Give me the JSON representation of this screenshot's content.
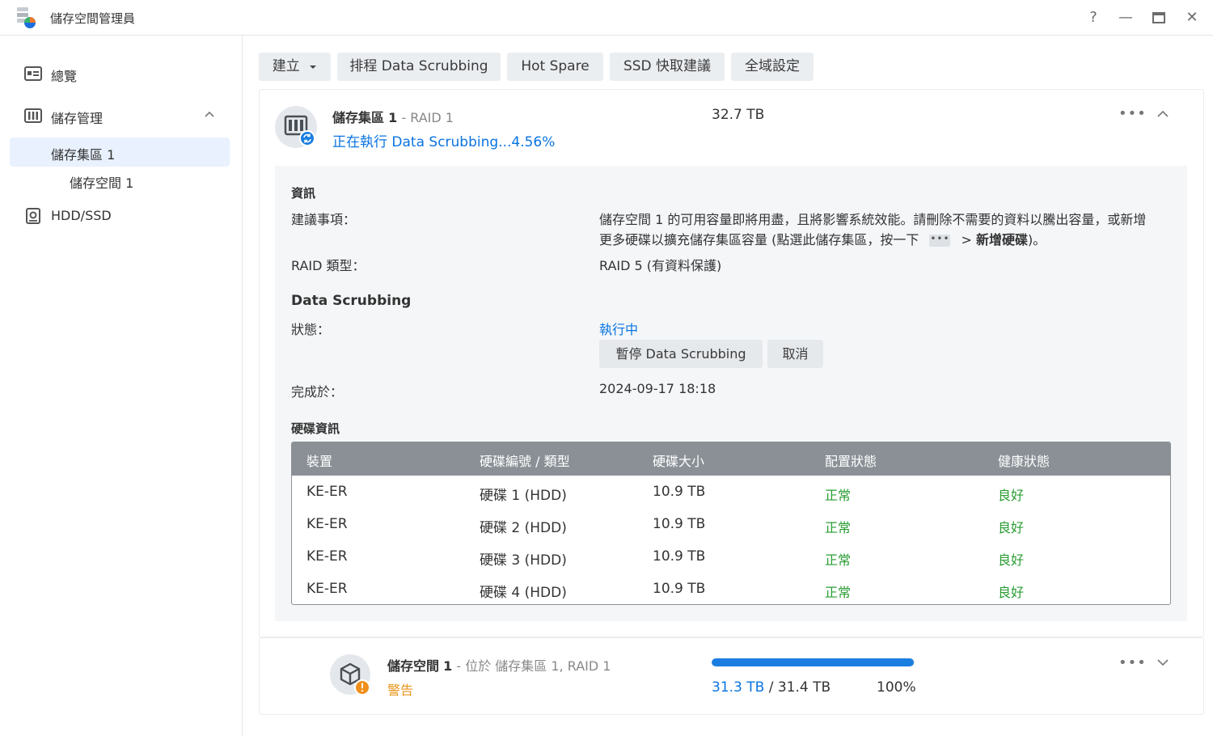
{
  "window": {
    "title": "儲存空間管理員",
    "buttons": {
      "help": "?",
      "minimize": "—",
      "maximize": "▭",
      "close": "✕"
    }
  },
  "sidebar": {
    "items": [
      {
        "label": "總覽",
        "icon": "overview-icon"
      },
      {
        "label": "儲存管理",
        "icon": "storage-icon",
        "expanded": true
      },
      {
        "label": "儲存集區 1",
        "selected": true
      },
      {
        "label": "儲存空間 1"
      },
      {
        "label": "HDD/SSD",
        "icon": "disk-icon"
      }
    ]
  },
  "toolbar": {
    "create": "建立",
    "schedule": "排程 Data Scrubbing",
    "hot_spare": "Hot Spare",
    "ssd_cache": "SSD 快取建議",
    "global": "全域設定"
  },
  "pool": {
    "name": "儲存集區",
    "number": "1",
    "separator": "-",
    "raid": "RAID 1",
    "status": "正在執行 Data Scrubbing...4.56%",
    "size": "32.7 TB",
    "info": {
      "heading": "資訊",
      "suggestion_label": "建議事項：",
      "suggestion_line1": "儲存空間 1 的可用容量即將用盡，且將影響系統效能。請刪除不需要的資料以騰出容量，或新增",
      "suggestion_line2a": "更多硬碟以擴充儲存集區容量 (點選此儲存集區，按一下",
      "suggestion_dots": "•••",
      "suggestion_line2b": "> ",
      "suggestion_bold": "新增硬碟",
      "suggestion_end": ")。",
      "raid_label": "RAID 類型：",
      "raid_value": "RAID 5 (有資料保護)"
    },
    "scrubbing": {
      "heading": "Data Scrubbing",
      "status_label": "狀態：",
      "status_value": "執行中",
      "pause_button": "暫停 Data Scrubbing",
      "cancel_button": "取消",
      "completed_label": "完成於：",
      "completed_value": "2024-09-17 18:18"
    },
    "disks": {
      "heading": "硬碟資訊",
      "columns": [
        "裝置",
        "硬碟編號 / 類型",
        "硬碟大小",
        "配置狀態",
        "健康狀態"
      ],
      "rows": [
        [
          "KE-ER",
          "硬碟 1 (HDD)",
          "10.9 TB",
          "正常",
          "良好"
        ],
        [
          "KE-ER",
          "硬碟 2 (HDD)",
          "10.9 TB",
          "正常",
          "良好"
        ],
        [
          "KE-ER",
          "硬碟 3 (HDD)",
          "10.9 TB",
          "正常",
          "良好"
        ],
        [
          "KE-ER",
          "硬碟 4 (HDD)",
          "10.9 TB",
          "正常",
          "良好"
        ]
      ]
    }
  },
  "volume": {
    "name": "儲存空間",
    "number": "1",
    "location": "- 位於 儲存集區 1, RAID 1",
    "status": "警告",
    "used": "31.3 TB",
    "total": "/ 31.4 TB",
    "percent": "100%",
    "usage_fraction": 0.997
  },
  "colors": {
    "accent": "#0a74e0",
    "healthy": "#2a9d33",
    "warning": "#e8941a",
    "selected_bg": "#e8f1fd",
    "table_header": "#8a9096"
  }
}
